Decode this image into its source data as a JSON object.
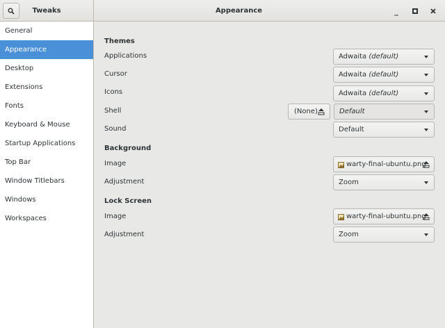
{
  "app_title": "Tweaks",
  "page_title": "Appearance",
  "window_controls": {
    "minimize": "_",
    "maximize": "□",
    "close": "×"
  },
  "sidebar": {
    "items": [
      {
        "label": "General"
      },
      {
        "label": "Appearance",
        "active": true
      },
      {
        "label": "Desktop"
      },
      {
        "label": "Extensions"
      },
      {
        "label": "Fonts"
      },
      {
        "label": "Keyboard & Mouse"
      },
      {
        "label": "Startup Applications"
      },
      {
        "label": "Top Bar"
      },
      {
        "label": "Window Titlebars"
      },
      {
        "label": "Windows"
      },
      {
        "label": "Workspaces"
      }
    ]
  },
  "themes": {
    "heading": "Themes",
    "applications": {
      "label": "Applications",
      "value": "Adwaita",
      "suffix": "(default)"
    },
    "cursor": {
      "label": "Cursor",
      "value": "Adwaita",
      "suffix": "(default)"
    },
    "icons": {
      "label": "Icons",
      "value": "Adwaita",
      "suffix": "(default)"
    },
    "shell": {
      "label": "Shell",
      "button": "(None)",
      "value": "Default"
    },
    "sound": {
      "label": "Sound",
      "value": "Default"
    }
  },
  "background": {
    "heading": "Background",
    "image": {
      "label": "Image",
      "file": "warty-final-ubuntu.png"
    },
    "adjustment": {
      "label": "Adjustment",
      "value": "Zoom"
    }
  },
  "lock_screen": {
    "heading": "Lock Screen",
    "image": {
      "label": "Image",
      "file": "warty-final-ubuntu.png"
    },
    "adjustment": {
      "label": "Adjustment",
      "value": "Zoom"
    }
  },
  "colors": {
    "accent": "#4a90d9",
    "sidebar_bg": "#ffffff",
    "content_bg": "#e8e8e7"
  }
}
